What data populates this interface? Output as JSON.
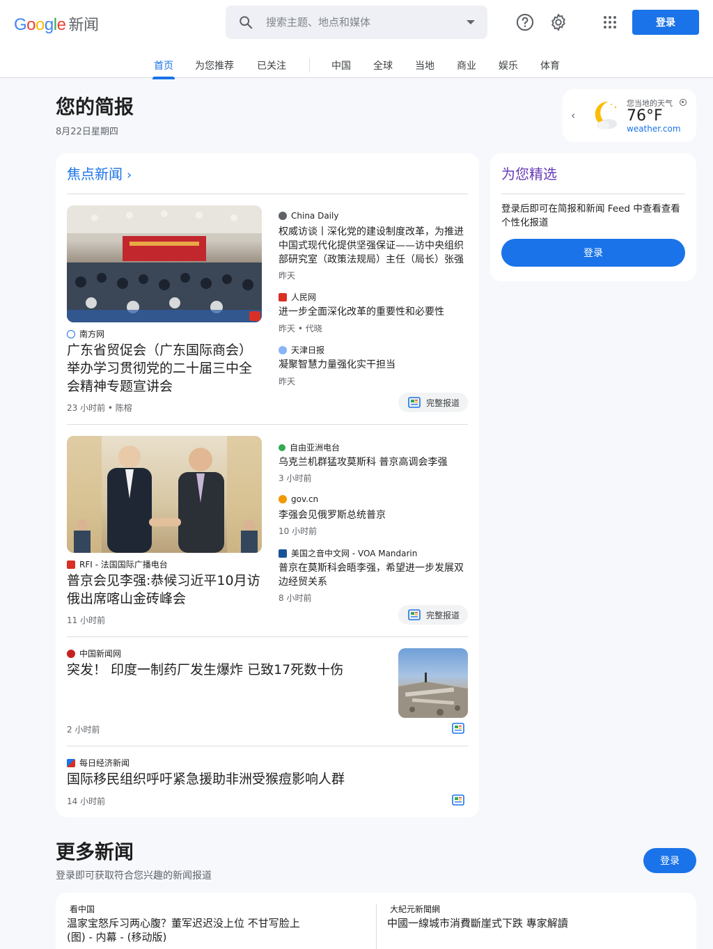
{
  "header": {
    "logo_google": [
      "G",
      "o",
      "o",
      "g",
      "l",
      "e"
    ],
    "logo_news": "新闻",
    "search_placeholder": "搜索主题、地点和媒体",
    "login_label": "登录"
  },
  "tabs": [
    {
      "label": "首页",
      "active": true
    },
    {
      "label": "为您推荐"
    },
    {
      "label": "已关注"
    },
    {
      "label": "中国"
    },
    {
      "label": "全球"
    },
    {
      "label": "当地"
    },
    {
      "label": "商业"
    },
    {
      "label": "娱乐"
    },
    {
      "label": "体育"
    }
  ],
  "briefing": {
    "title": "您的简报",
    "date": "8月22日星期四"
  },
  "weather": {
    "label": "您当地的天气",
    "temp": "76°F",
    "source": "weather.com"
  },
  "top_stories": {
    "heading": "焦点新闻",
    "clusters": [
      {
        "main": {
          "source": "南方网",
          "headline": "广东省贸促会（广东国际商会）举办学习贯彻党的二十届三中全会精神专题宣讲会",
          "meta": "23 小时前 • 陈榕"
        },
        "related": [
          {
            "source": "China Daily",
            "headline": "权威访谈丨深化党的建设制度改革，为推进中国式现代化提供坚强保证——访中央组织部研究室（政策法规局）主任（局长）张强",
            "meta": "昨天"
          },
          {
            "source": "人民网",
            "headline": "进一步全面深化改革的重要性和必要性",
            "meta": "昨天 • 代晓"
          },
          {
            "source": "天津日报",
            "headline": "凝聚智慧力量强化实干担当",
            "meta": "昨天"
          }
        ],
        "full_coverage": "完整报道"
      },
      {
        "main": {
          "source": "RFI - 法国国际广播电台",
          "headline": "普京会见李强:恭候习近平10月访俄出席喀山金砖峰会",
          "meta": "11 小时前"
        },
        "related": [
          {
            "source": "自由亚洲电台",
            "headline": "乌克兰机群猛攻莫斯科 普京高调会李强",
            "meta": "3 小时前"
          },
          {
            "source": "gov.cn",
            "headline": "李强会见俄罗斯总统普京",
            "meta": "10 小时前"
          },
          {
            "source": "美国之音中文网 - VOA Mandarin",
            "headline": "普京在莫斯科会晤李强，希望进一步发展双边经贸关系",
            "meta": "8 小时前"
          }
        ],
        "full_coverage": "完整报道"
      }
    ],
    "singles": [
      {
        "source": "中国新闻网",
        "headline": "突发！ 印度一制药厂发生爆炸 已致17死数十伤",
        "meta": "2 小时前"
      },
      {
        "source": "每日经济新闻",
        "headline": "国际移民组织呼吁紧急援助非洲受猴痘影响人群",
        "meta": "14 小时前"
      }
    ]
  },
  "picks": {
    "title": "为您精选",
    "desc": "登录后即可在简报和新闻 Feed 中查看查看个性化报道",
    "button": "登录"
  },
  "more": {
    "title": "更多新闻",
    "subtitle": "登录即可获取符合您兴趣的新闻报道",
    "button": "登录",
    "items": [
      {
        "source": "看中国",
        "headline": "温家宝怒斥习两心腹？董军迟迟没上位 不甘写脸上(图) - 内幕 - (移动版)"
      },
      {
        "source": "大紀元新聞網",
        "headline": "中國一線城市消費斷崖式下跌 專家解讀"
      }
    ]
  },
  "colors": {
    "accent": "#1a73e8",
    "picks": "#673ab7",
    "bg": "#f6f8fc"
  }
}
